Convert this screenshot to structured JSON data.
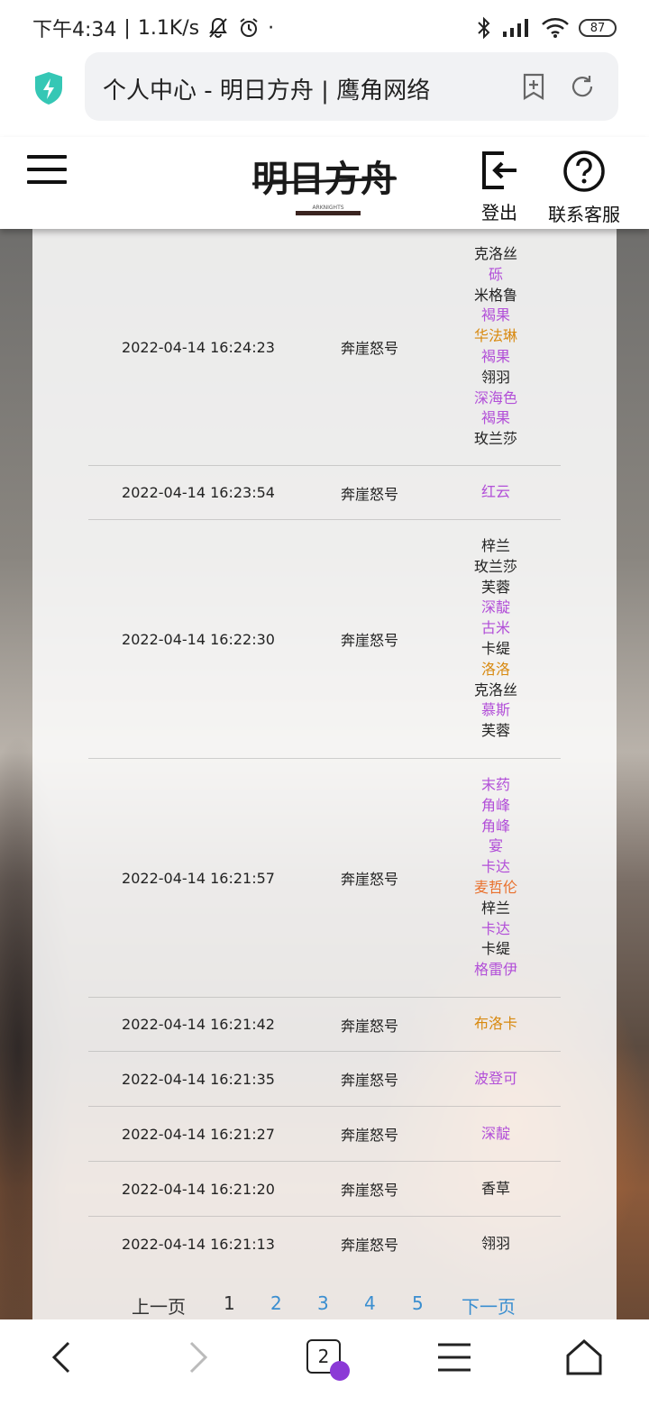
{
  "status_bar": {
    "time": "下午4:34",
    "speed": "1.1K/s",
    "battery": "87"
  },
  "url_bar": {
    "title": "个人中心 - 明日方舟 | 鹰角网络"
  },
  "header": {
    "logo_text": "明日方舟",
    "logo_sub": "ARKNIGHTS",
    "logout_label": "登出",
    "customer_service_label": "联系客服"
  },
  "colors": {
    "rarity3": "#222222",
    "rarity4": "#b24fd8",
    "rarity5": "#d8890f",
    "rarity6": "#e9702c",
    "pager_link": "#3a8ed0",
    "badge": "#8b3ad6"
  },
  "records": [
    {
      "time": "2022-04-14 16:24:23",
      "pool": "奔崖怒号",
      "operators": [
        {
          "name": "克洛丝",
          "rarity": 3
        },
        {
          "name": "砾",
          "rarity": 4
        },
        {
          "name": "米格鲁",
          "rarity": 3
        },
        {
          "name": "褐果",
          "rarity": 4
        },
        {
          "name": "华法琳",
          "rarity": 5
        },
        {
          "name": "褐果",
          "rarity": 4
        },
        {
          "name": "翎羽",
          "rarity": 3
        },
        {
          "name": "深海色",
          "rarity": 4
        },
        {
          "name": "褐果",
          "rarity": 4
        },
        {
          "name": "玫兰莎",
          "rarity": 3
        }
      ]
    },
    {
      "time": "2022-04-14 16:23:54",
      "pool": "奔崖怒号",
      "operators": [
        {
          "name": "红云",
          "rarity": 4
        }
      ]
    },
    {
      "time": "2022-04-14 16:22:30",
      "pool": "奔崖怒号",
      "operators": [
        {
          "name": "梓兰",
          "rarity": 3
        },
        {
          "name": "玫兰莎",
          "rarity": 3
        },
        {
          "name": "芙蓉",
          "rarity": 3
        },
        {
          "name": "深靛",
          "rarity": 4
        },
        {
          "name": "古米",
          "rarity": 4
        },
        {
          "name": "卡缇",
          "rarity": 3
        },
        {
          "name": "洛洛",
          "rarity": 5
        },
        {
          "name": "克洛丝",
          "rarity": 3
        },
        {
          "name": "慕斯",
          "rarity": 4
        },
        {
          "name": "芙蓉",
          "rarity": 3
        }
      ]
    },
    {
      "time": "2022-04-14 16:21:57",
      "pool": "奔崖怒号",
      "operators": [
        {
          "name": "末药",
          "rarity": 4
        },
        {
          "name": "角峰",
          "rarity": 4
        },
        {
          "name": "角峰",
          "rarity": 4
        },
        {
          "name": "宴",
          "rarity": 4
        },
        {
          "name": "卡达",
          "rarity": 4
        },
        {
          "name": "麦哲伦",
          "rarity": 6
        },
        {
          "name": "梓兰",
          "rarity": 3
        },
        {
          "name": "卡达",
          "rarity": 4
        },
        {
          "name": "卡缇",
          "rarity": 3
        },
        {
          "name": "格雷伊",
          "rarity": 4
        }
      ]
    },
    {
      "time": "2022-04-14 16:21:42",
      "pool": "奔崖怒号",
      "operators": [
        {
          "name": "布洛卡",
          "rarity": 5
        }
      ]
    },
    {
      "time": "2022-04-14 16:21:35",
      "pool": "奔崖怒号",
      "operators": [
        {
          "name": "波登可",
          "rarity": 4
        }
      ]
    },
    {
      "time": "2022-04-14 16:21:27",
      "pool": "奔崖怒号",
      "operators": [
        {
          "name": "深靛",
          "rarity": 4
        }
      ]
    },
    {
      "time": "2022-04-14 16:21:20",
      "pool": "奔崖怒号",
      "operators": [
        {
          "name": "香草",
          "rarity": 3
        }
      ]
    },
    {
      "time": "2022-04-14 16:21:13",
      "pool": "奔崖怒号",
      "operators": [
        {
          "name": "翎羽",
          "rarity": 3
        }
      ]
    }
  ],
  "pager": {
    "prev_label": "上一页",
    "pages": [
      "1",
      "2",
      "3",
      "4",
      "5"
    ],
    "current": "1",
    "next_label": "下一页"
  },
  "bottom_nav": {
    "tab_count": "2"
  }
}
